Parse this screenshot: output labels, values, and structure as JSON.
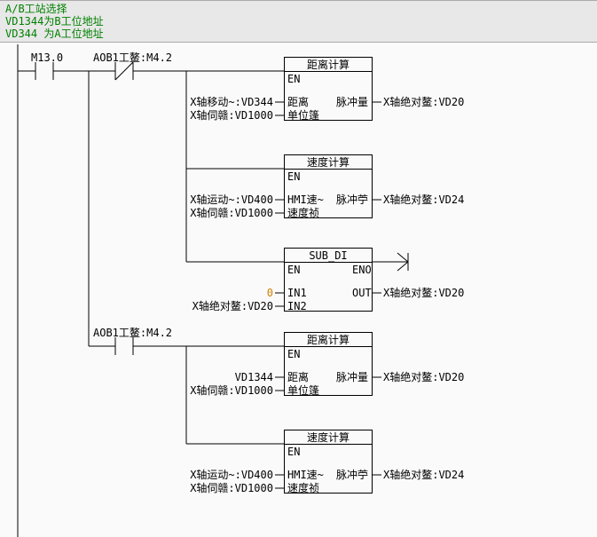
{
  "header": {
    "line1": "A/B工站选择",
    "line2": "VD1344为B工位地址",
    "line3": "VD344 为A工位地址"
  },
  "contacts": {
    "m13": "M13.0",
    "aob1_top": "AOB1工鳌:M4.2",
    "aob1_bot": "AOB1工鳌:M4.2"
  },
  "block1": {
    "title": "距离计算",
    "en": "EN",
    "in1_label": "X轴移动~:VD344",
    "in1_port": "距离",
    "in2_label": "X轴伺赣:VD1000",
    "in2_port": "单位篷",
    "out_port": "脉冲量",
    "out_label": "X轴绝对鳌:VD20"
  },
  "block2": {
    "title": "速度计算",
    "en": "EN",
    "in1_label": "X轴运动~:VD400",
    "in1_port": "HMI速~",
    "in2_label": "X轴伺赣:VD1000",
    "in2_port": "速度祯",
    "out_port": "脉冲苧",
    "out_label": "X轴绝对鳌:VD24"
  },
  "block3": {
    "title": "SUB_DI",
    "en": "EN",
    "eno": "ENO",
    "in1_val": "0",
    "in1_port": "IN1",
    "in2_label": "X轴绝对鳌:VD20",
    "in2_port": "IN2",
    "out_port": "OUT",
    "out_label": "X轴绝对鳌:VD20"
  },
  "block4": {
    "title": "距离计算",
    "en": "EN",
    "in1_label": "VD1344",
    "in1_port": "距离",
    "in2_label": "X轴伺赣:VD1000",
    "in2_port": "单位篷",
    "out_port": "脉冲量",
    "out_label": "X轴绝对鳌:VD20"
  },
  "block5": {
    "title": "速度计算",
    "en": "EN",
    "in1_label": "X轴运动~:VD400",
    "in1_port": "HMI速~",
    "in2_label": "X轴伺赣:VD1000",
    "in2_port": "速度祯",
    "out_port": "脉冲苧",
    "out_label": "X轴绝对鳌:VD24"
  }
}
